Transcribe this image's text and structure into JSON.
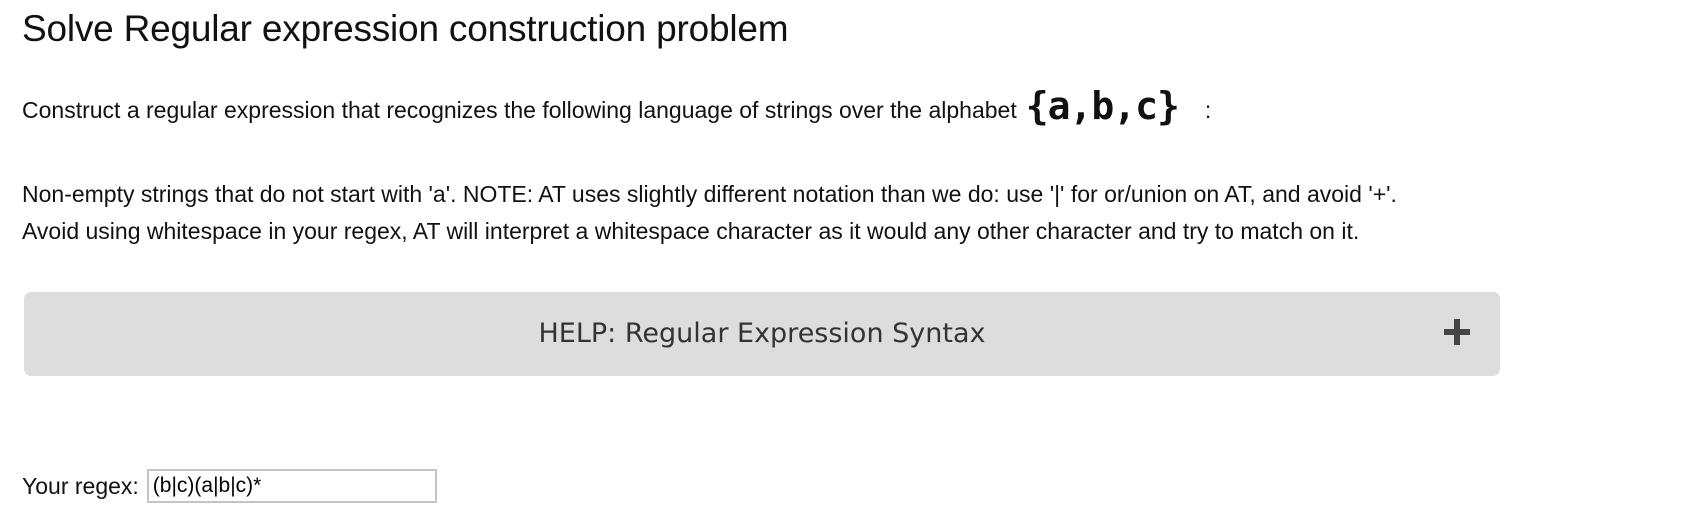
{
  "page": {
    "title": "Solve Regular expression construction problem"
  },
  "intro": {
    "text": "Construct a regular expression that recognizes the following language of strings over the alphabet",
    "alphabet": "{a,b,c}",
    "colon": ":"
  },
  "description": {
    "line1": "Non-empty strings that do not start with 'a'. NOTE: AT uses slightly different notation than we do: use '|' for or/union on AT, and avoid '+'.",
    "line2": "Avoid using whitespace in your regex, AT will interpret a whitespace character as it would any other character and try to match on it."
  },
  "help": {
    "title": "HELP: Regular Expression Syntax",
    "icon": "plus-icon"
  },
  "regex": {
    "label": "Your regex:",
    "value": "(b|c)(a|b|c)*"
  },
  "colors": {
    "help_bg": "#dddddd",
    "help_text": "#333333"
  }
}
